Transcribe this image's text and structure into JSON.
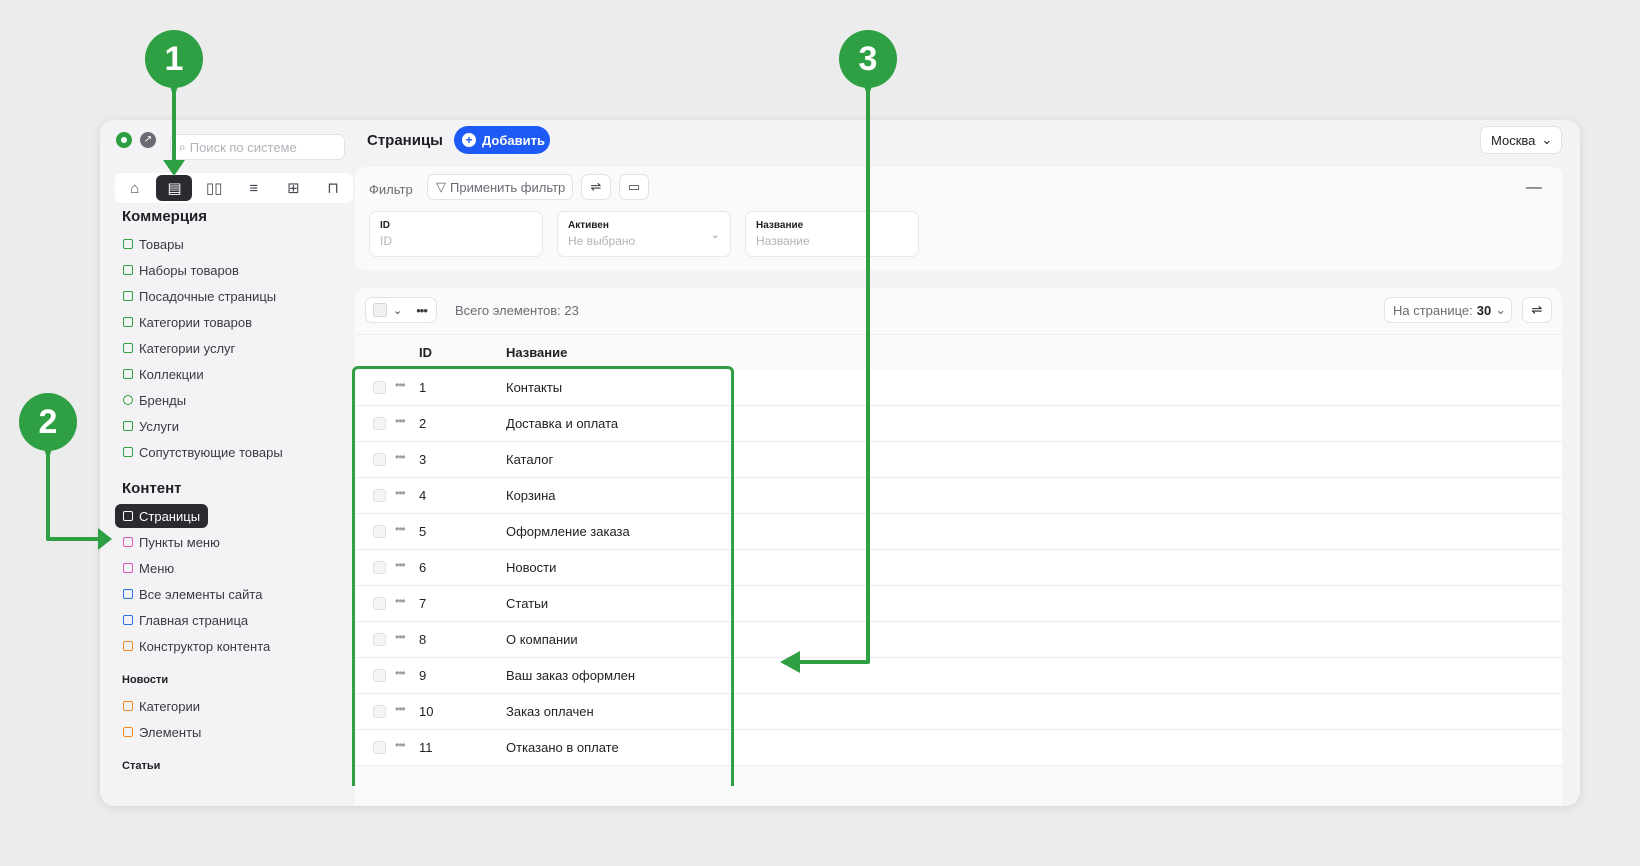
{
  "colors": {
    "accent": "#1e5bf6",
    "annotation": "#2ea043",
    "active_nav": "#2a2a30"
  },
  "annotations": {
    "m1": "1",
    "m2": "2",
    "m3": "3"
  },
  "sidebar": {
    "search_placeholder": "Поиск по системе",
    "icons": [
      "dashboard-icon",
      "content-icon",
      "book-icon",
      "sliders-icon",
      "plus-square-icon",
      "paint-icon"
    ],
    "commerce_title": "Коммерция",
    "commerce_items": [
      "Товары",
      "Наборы товаров",
      "Посадочные страницы",
      "Категории товаров",
      "Категории услуг",
      "Коллекции",
      "Бренды",
      "Услуги",
      "Сопутствующие товары"
    ],
    "content_title": "Контент",
    "content_items": [
      "Страницы",
      "Пункты меню",
      "Меню",
      "Все элементы сайта",
      "Главная страница",
      "Конструктор контента"
    ],
    "news_title": "Новости",
    "news_items": [
      "Категории",
      "Элементы"
    ],
    "articles_title": "Статьи"
  },
  "header": {
    "title": "Страницы",
    "add_label": "Добавить",
    "city": "Москва"
  },
  "filter": {
    "label": "Фильтр",
    "apply_label": "Применить фильтр",
    "fields": [
      {
        "label": "ID",
        "placeholder": "ID"
      },
      {
        "label": "Активен",
        "placeholder": "Не выбрано"
      },
      {
        "label": "Название",
        "placeholder": "Название"
      }
    ]
  },
  "table": {
    "total": "Всего элементов: 23",
    "per_page_label": "На странице:",
    "per_page_value": "30",
    "columns": [
      "ID",
      "Название"
    ],
    "rows": [
      {
        "id": "1",
        "name": "Контакты"
      },
      {
        "id": "2",
        "name": "Доставка и оплата"
      },
      {
        "id": "3",
        "name": "Каталог"
      },
      {
        "id": "4",
        "name": "Корзина"
      },
      {
        "id": "5",
        "name": "Оформление заказа"
      },
      {
        "id": "6",
        "name": "Новости"
      },
      {
        "id": "7",
        "name": "Статьи"
      },
      {
        "id": "8",
        "name": "О компании"
      },
      {
        "id": "9",
        "name": "Ваш заказ оформлен"
      },
      {
        "id": "10",
        "name": "Заказ оплачен"
      },
      {
        "id": "11",
        "name": "Отказано в оплате"
      }
    ]
  }
}
